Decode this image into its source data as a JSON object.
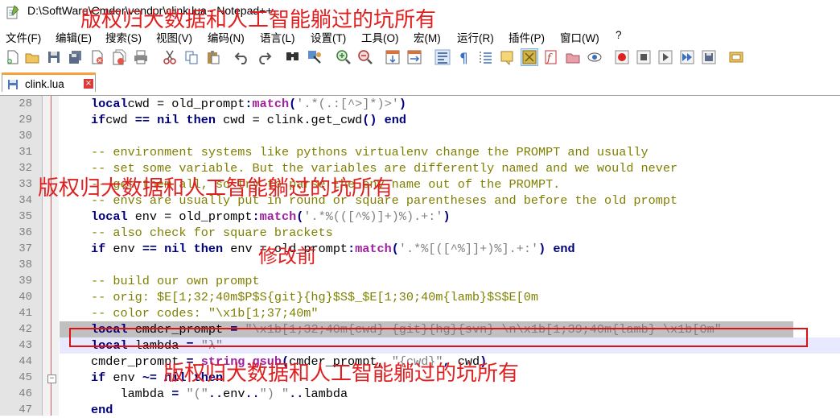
{
  "window": {
    "title": "D:\\SoftWare\\Cmder\\vendor\\clink.lua - Notepad++"
  },
  "watermark": "版权归大数据和人工智能躺过的坑所有",
  "annotation": "修改前",
  "menu": [
    "文件(F)",
    "编辑(E)",
    "搜索(S)",
    "视图(V)",
    "编码(N)",
    "语言(L)",
    "设置(T)",
    "工具(O)",
    "宏(M)",
    "运行(R)",
    "插件(P)",
    "窗口(W)",
    "?"
  ],
  "tab": {
    "label": "clink.lua",
    "close_symbol": "×"
  },
  "editor": {
    "lines": [
      {
        "num": "28",
        "tokens": [
          [
            "kw",
            "local"
          ],
          [
            "",
            "cwd = old_prompt"
          ],
          [
            "op",
            ":"
          ],
          [
            "meth",
            "match"
          ],
          [
            "op",
            "("
          ],
          [
            "str",
            "'.*(.:[^>]*)>'"
          ],
          [
            "op",
            ")"
          ]
        ]
      },
      {
        "num": "29",
        "tokens": [
          [
            "kw",
            "if"
          ],
          [
            "",
            "cwd "
          ],
          [
            "op",
            "=="
          ],
          [
            "",
            " "
          ],
          [
            "kw",
            "nil"
          ],
          [
            "",
            " "
          ],
          [
            "kw",
            "then"
          ],
          [
            "",
            " cwd = clink.get_cwd"
          ],
          [
            "op",
            "()"
          ],
          [
            "",
            " "
          ],
          [
            "kw",
            "end"
          ]
        ]
      },
      {
        "num": "30",
        "tokens": []
      },
      {
        "num": "31",
        "tokens": [
          [
            "cm",
            "-- environment systems like pythons virtualenv change the PROMPT and usually"
          ]
        ]
      },
      {
        "num": "32",
        "tokens": [
          [
            "cm",
            "-- set some variable. But the variables are differently named and we would never"
          ]
        ]
      },
      {
        "num": "33",
        "tokens": [
          [
            "cm",
            "-- get them all, so try to parse the env name out of the PROMPT."
          ]
        ]
      },
      {
        "num": "34",
        "tokens": [
          [
            "cm",
            "-- envs are usually put in round or square parentheses and before the old prompt"
          ]
        ]
      },
      {
        "num": "35",
        "tokens": [
          [
            "kw",
            "local"
          ],
          [
            "",
            " env = old_prompt"
          ],
          [
            "op",
            ":"
          ],
          [
            "meth",
            "match"
          ],
          [
            "op",
            "("
          ],
          [
            "str",
            "'.*%(([^%)]+)%).+:'"
          ],
          [
            "op",
            ")"
          ]
        ]
      },
      {
        "num": "36",
        "tokens": [
          [
            "cm",
            "-- also check for square brackets"
          ]
        ]
      },
      {
        "num": "37",
        "tokens": [
          [
            "kw",
            "if"
          ],
          [
            "",
            " env "
          ],
          [
            "op",
            "=="
          ],
          [
            "",
            " "
          ],
          [
            "kw",
            "nil"
          ],
          [
            "",
            " "
          ],
          [
            "kw",
            "then"
          ],
          [
            "",
            " env = old_prompt"
          ],
          [
            "op",
            ":"
          ],
          [
            "meth",
            "match"
          ],
          [
            "op",
            "("
          ],
          [
            "str",
            "'.*%[([^%]]+)%].+:'"
          ],
          [
            "op",
            ")"
          ],
          [
            "",
            " "
          ],
          [
            "kw",
            "end"
          ]
        ]
      },
      {
        "num": "38",
        "tokens": []
      },
      {
        "num": "39",
        "tokens": [
          [
            "cm",
            "-- build our own prompt"
          ]
        ]
      },
      {
        "num": "40",
        "tokens": [
          [
            "cm",
            "-- orig: $E[1;32;40m$P$S{git}{hg}$S$_$E[1;30;40m{lamb}$S$E[0m"
          ]
        ]
      },
      {
        "num": "41",
        "tokens": [
          [
            "cm",
            "-- color codes: \"\\x1b[1;37;40m\""
          ]
        ]
      },
      {
        "num": "42",
        "tokens": [
          [
            "kw",
            "local"
          ],
          [
            "",
            " cmder_prompt "
          ],
          [
            "op",
            "="
          ],
          [
            "",
            " "
          ],
          [
            "str",
            "\"\\x1b[1;32;40m{cwd} {git}{hg}{svn} \\n\\x1b[1;39;40m{lamb} \\x1b[0m\""
          ]
        ]
      },
      {
        "num": "43",
        "tokens": [
          [
            "kw",
            "local"
          ],
          [
            "",
            " lambda "
          ],
          [
            "op",
            "="
          ],
          [
            "",
            " "
          ],
          [
            "str",
            "\"λ\""
          ]
        ]
      },
      {
        "num": "44",
        "tokens": [
          [
            "",
            "cmder_prompt "
          ],
          [
            "op",
            "="
          ],
          [
            "",
            " "
          ],
          [
            "meth",
            "string.gsub"
          ],
          [
            "op",
            "("
          ],
          [
            "",
            "cmder_prompt, "
          ],
          [
            "str",
            "\"{cwd}\""
          ],
          [
            "op",
            ","
          ],
          [
            "",
            " cwd"
          ],
          [
            "op",
            ")"
          ]
        ]
      },
      {
        "num": "45",
        "tokens": [
          [
            "kw",
            "if"
          ],
          [
            "",
            " env "
          ],
          [
            "op",
            "~="
          ],
          [
            "",
            " "
          ],
          [
            "kw",
            "nil"
          ],
          [
            "",
            " "
          ],
          [
            "kw",
            "then"
          ]
        ]
      },
      {
        "num": "46",
        "tokens": [
          [
            "",
            "    lambda "
          ],
          [
            "op",
            "="
          ],
          [
            "",
            " "
          ],
          [
            "str",
            "\"(\""
          ],
          [
            "op",
            ".."
          ],
          [
            "",
            "env"
          ],
          [
            "op",
            ".."
          ],
          [
            "str",
            "\") \""
          ],
          [
            "op",
            ".."
          ],
          [
            "",
            "lambda"
          ]
        ]
      },
      {
        "num": "47",
        "tokens": [
          [
            "kw",
            "end"
          ]
        ]
      }
    ]
  }
}
